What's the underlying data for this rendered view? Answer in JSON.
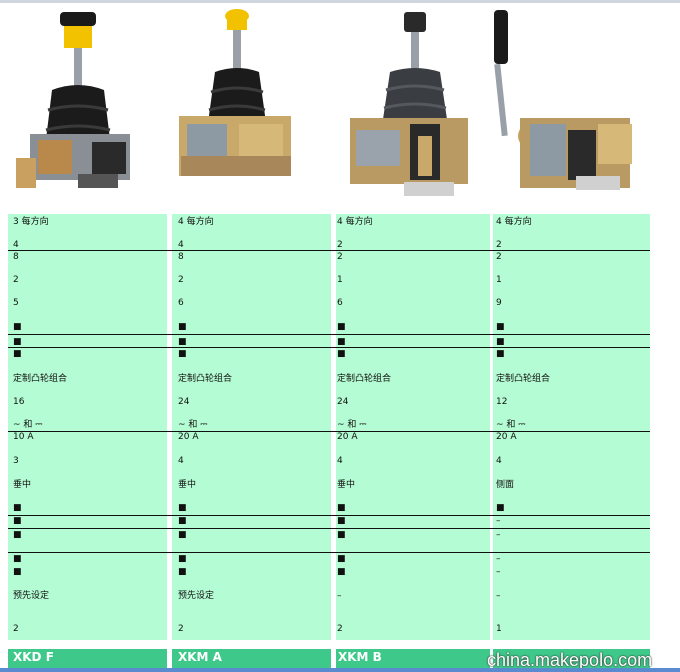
{
  "columns": [
    {
      "rows": [
        "3 每方向",
        "4",
        "8",
        "2",
        "5",
        "■",
        "■",
        "■",
        "定制凸轮组合",
        "16",
        "~ 和 ⎓",
        "10 A",
        "3",
        "垂中",
        "■",
        "■",
        "■",
        "■",
        "■",
        "预先设定",
        "2"
      ],
      "footer": "XKD F"
    },
    {
      "rows": [
        "4 每方向",
        "4",
        "8",
        "2",
        "6",
        "■",
        "■",
        "■",
        "定制凸轮组合",
        "24",
        "~ 和 ⎓",
        "20 A",
        "4",
        "垂中",
        "■",
        "■",
        "■",
        "■",
        "■",
        "预先设定",
        "2"
      ],
      "footer": "XKM A"
    },
    {
      "rows": [
        "4 每方向",
        "2",
        "2",
        "1",
        "6",
        "■",
        "■",
        "■",
        "定制凸轮组合",
        "24",
        "~ 和 ⎓",
        "20 A",
        "4",
        "垂中",
        "■",
        "■",
        "■",
        "■",
        "■",
        "–",
        "2"
      ],
      "footer": "XKM B"
    },
    {
      "rows": [
        "4 每方向",
        "2",
        "2",
        "1",
        "9",
        "■",
        "■",
        "■",
        "定制凸轮组合",
        "12",
        "~ 和 ⎓",
        "20 A",
        "4",
        "侧面",
        "■",
        "–",
        "–",
        "–",
        "–",
        "–",
        "1"
      ],
      "footer": ""
    }
  ],
  "watermark": "china.makepolo.com",
  "colors": {
    "row_bg": "#b4fcd3",
    "footer_bg": "#3ec98a",
    "knob_black": "#1a1a1a",
    "knob_yellow": "#f2c200"
  }
}
